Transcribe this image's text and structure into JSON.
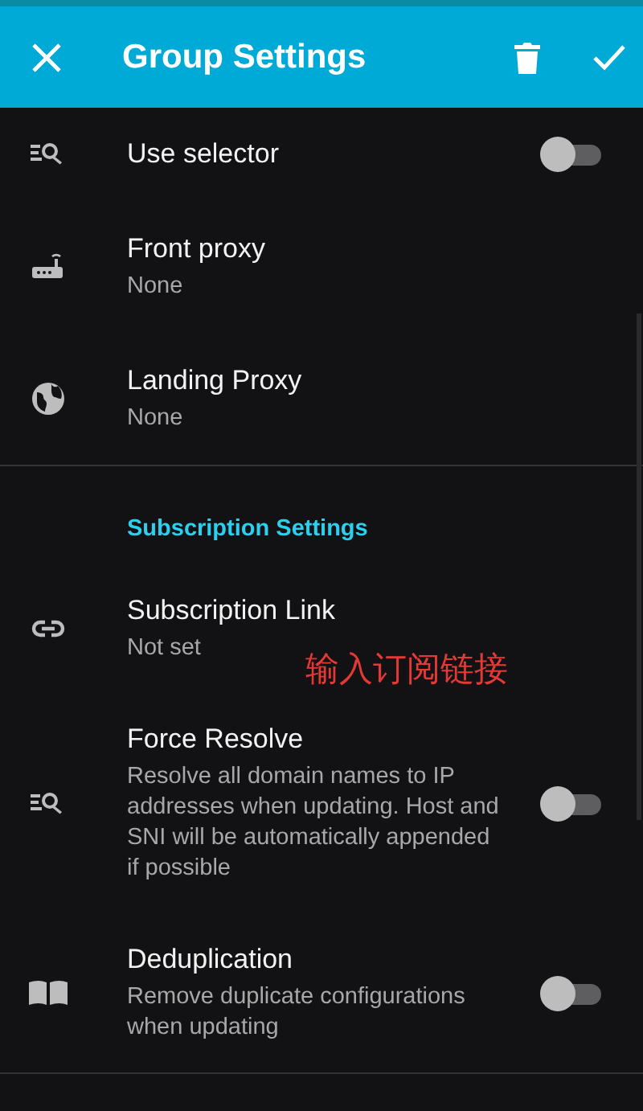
{
  "app_bar": {
    "title": "Group Settings"
  },
  "sections": [
    {
      "rows": [
        {
          "kind": "toggle",
          "title": "Use selector",
          "on": false
        },
        {
          "kind": "text",
          "title": "Front proxy",
          "summary": "None"
        },
        {
          "kind": "text",
          "title": "Landing Proxy",
          "summary": "None"
        }
      ]
    },
    {
      "header": "Subscription Settings",
      "rows": [
        {
          "kind": "text",
          "title": "Subscription Link",
          "summary": "Not set"
        },
        {
          "kind": "toggle",
          "title": "Force Resolve",
          "summary": "Resolve all domain names to IP addresses when updating. Host and SNI will be automatically appended if possible",
          "on": false
        },
        {
          "kind": "toggle",
          "title": "Deduplication",
          "summary": "Remove duplicate configurations when updating",
          "on": false
        }
      ]
    }
  ],
  "annotation": "输入订阅链接"
}
